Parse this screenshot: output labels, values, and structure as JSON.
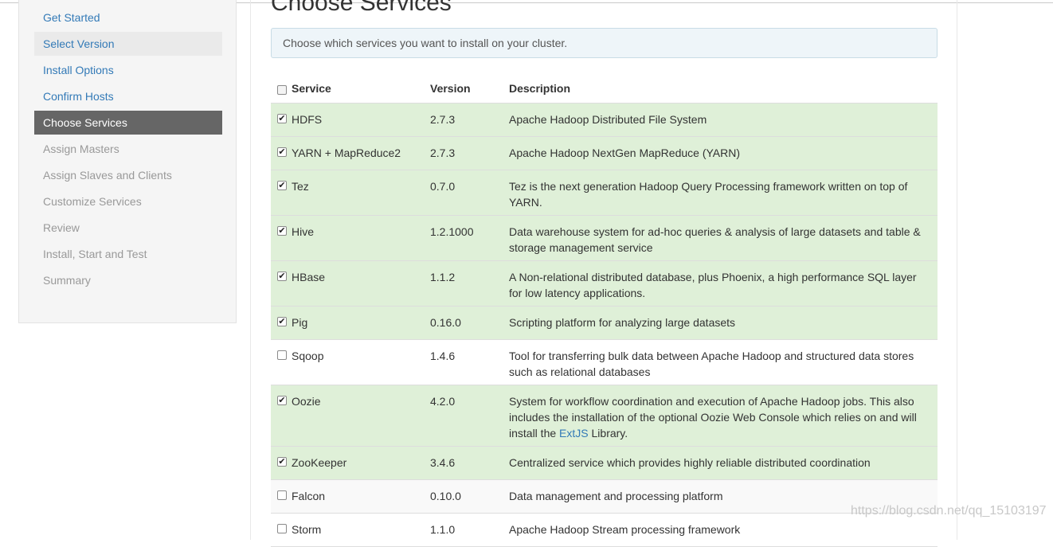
{
  "sidebar": {
    "steps": [
      {
        "label": "Get Started",
        "state": "done"
      },
      {
        "label": "Select Version",
        "state": "done-hl"
      },
      {
        "label": "Install Options",
        "state": "done"
      },
      {
        "label": "Confirm Hosts",
        "state": "done"
      },
      {
        "label": "Choose Services",
        "state": "active"
      },
      {
        "label": "Assign Masters",
        "state": "todo"
      },
      {
        "label": "Assign Slaves and Clients",
        "state": "todo"
      },
      {
        "label": "Customize Services",
        "state": "todo"
      },
      {
        "label": "Review",
        "state": "todo"
      },
      {
        "label": "Install, Start and Test",
        "state": "todo"
      },
      {
        "label": "Summary",
        "state": "todo"
      }
    ]
  },
  "main": {
    "title": "Choose Services",
    "info": "Choose which services you want to install on your cluster."
  },
  "table": {
    "headers": {
      "service": "Service",
      "version": "Version",
      "description": "Description"
    },
    "select_all_checked": false,
    "rows": [
      {
        "service": "HDFS",
        "version": "2.7.3",
        "description": "Apache Hadoop Distributed File System",
        "checked": true
      },
      {
        "service": "YARN + MapReduce2",
        "version": "2.7.3",
        "description": "Apache Hadoop NextGen MapReduce (YARN)",
        "checked": true
      },
      {
        "service": "Tez",
        "version": "0.7.0",
        "description": "Tez is the next generation Hadoop Query Processing framework written on top of YARN.",
        "checked": true
      },
      {
        "service": "Hive",
        "version": "1.2.1000",
        "description": "Data warehouse system for ad-hoc queries & analysis of large datasets and table & storage management service",
        "checked": true
      },
      {
        "service": "HBase",
        "version": "1.1.2",
        "description": "A Non-relational distributed database, plus Phoenix, a high performance SQL layer for low latency applications.",
        "checked": true
      },
      {
        "service": "Pig",
        "version": "0.16.0",
        "description": "Scripting platform for analyzing large datasets",
        "checked": true
      },
      {
        "service": "Sqoop",
        "version": "1.4.6",
        "description": "Tool for transferring bulk data between Apache Hadoop and structured data stores such as relational databases",
        "checked": false
      },
      {
        "service": "Oozie",
        "version": "4.2.0",
        "description": "System for workflow coordination and execution of Apache Hadoop jobs. This also includes the installation of the optional Oozie Web Console which relies on and will install the",
        "description_link": "ExtJS",
        "description_tail": " Library.",
        "checked": true
      },
      {
        "service": "ZooKeeper",
        "version": "3.4.6",
        "description": "Centralized service which provides highly reliable distributed coordination",
        "checked": true
      },
      {
        "service": "Falcon",
        "version": "0.10.0",
        "description": "Data management and processing platform",
        "checked": false
      },
      {
        "service": "Storm",
        "version": "1.1.0",
        "description": "Apache Hadoop Stream processing framework",
        "checked": false
      }
    ]
  },
  "watermark": "https://blog.csdn.net/qq_15103197",
  "colors": {
    "link": "#337ab7",
    "active_step_bg": "#666666",
    "selected_row_bg": "#dff0d8",
    "info_bg": "#eef5f9"
  }
}
